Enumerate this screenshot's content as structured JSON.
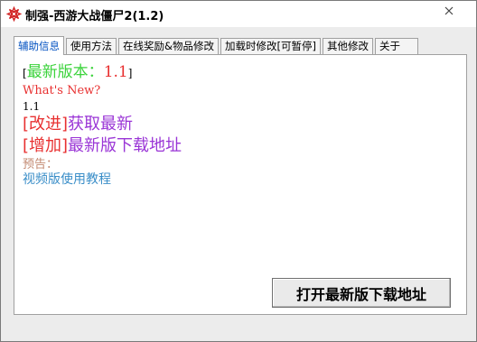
{
  "window": {
    "title": "制强-西游大战僵尸2(1.2)",
    "icon": "flower-logo-icon",
    "close_icon": "close-icon",
    "colors": {
      "active_tab_text": "#0050c0",
      "tab_border": "#a0a0a0"
    }
  },
  "tabs": [
    {
      "label": "辅助信息",
      "active": true
    },
    {
      "label": "使用方法",
      "active": false
    },
    {
      "label": "在线奖励&物品修改",
      "active": false
    },
    {
      "label": "加载时修改[可暂停]",
      "active": false
    },
    {
      "label": "其他修改",
      "active": false
    },
    {
      "label": "关于",
      "active": false
    }
  ],
  "info": {
    "bracket_open": "[",
    "bracket_close": "]",
    "version_label": "最新版本：",
    "version_value": "1.1",
    "whats_new": "What's New?",
    "new_version": "1.1",
    "item1_tag": "[改进]",
    "item1_text": "获取最新",
    "item2_tag": "[增加]",
    "item2_text": "最新版下载地址",
    "preview_label": "预告：",
    "preview_text": "视频版使用教程",
    "colors": {
      "green": "#3cd33c",
      "red": "#e83030",
      "violet": "#9a35d6",
      "tan": "#c28870",
      "blue": "#3a8ec8"
    }
  },
  "buttons": {
    "open_download": "打开最新版下载地址"
  }
}
